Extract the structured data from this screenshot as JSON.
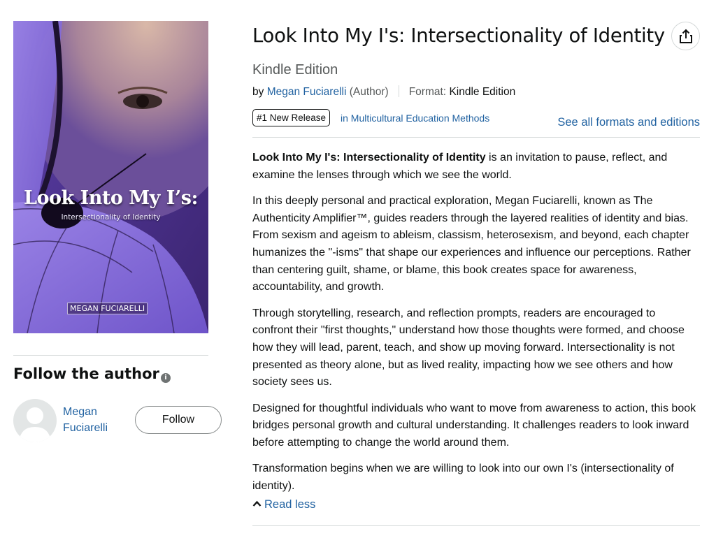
{
  "book": {
    "title": "Look Into My I's: Intersectionality of Identity",
    "edition": "Kindle Edition",
    "byline_prefix": "by",
    "author_name": "Megan Fuciarelli",
    "author_role": "(Author)",
    "format_label": "Format:",
    "format_value": "Kindle Edition",
    "badge": "#1 New Release",
    "category_link": "in Multicultural Education Methods",
    "formats_link": "See all formats and editions"
  },
  "cover": {
    "title": "Look Into My I’s:",
    "subtitle": "Intersectionality of Identity",
    "author": "MEGAN FUCIARELLI"
  },
  "follow": {
    "heading": "Follow the author",
    "author_first": "Megan",
    "author_last": "Fuciarelli",
    "button": "Follow"
  },
  "description": {
    "lead_bold": "Look Into My I's: Intersectionality of Identity",
    "lead_rest": " is an invitation to pause, reflect, and examine the lenses through which we see the world.",
    "p2": "In this deeply personal and practical exploration, Megan Fuciarelli, known as The Authenticity Amplifier™, guides readers through the layered realities of identity and bias. From sexism and ageism to ableism, classism, heterosexism, and beyond, each chapter humanizes the \"-isms\" that shape our experiences and influence our perceptions. Rather than centering guilt, shame, or blame, this book creates space for awareness, accountability, and growth.",
    "p3": "Through storytelling, research, and reflection prompts, readers are encouraged to confront their \"first thoughts,\" understand how those thoughts were formed, and choose how they will lead, parent, teach, and show up moving forward. Intersectionality is not presented as theory alone, but as lived reality, impacting how we see others and how society sees us.",
    "p4": "Designed for thoughtful individuals who want to move from awareness to action, this book bridges personal growth and cultural understanding. It challenges readers to look inward before attempting to change the world around them.",
    "p5": "Transformation begins when we are willing to look into our own I's (intersectionality of identity).",
    "read_less": "Read less"
  },
  "colors": {
    "link": "#2162a1",
    "text": "#0f1111",
    "muted": "#565959",
    "cover_purple": "#6a4fc4"
  },
  "icons": {
    "share": "share-icon",
    "info": "info-icon",
    "avatar": "avatar-placeholder-icon",
    "chevron": "chevron-up-icon"
  }
}
